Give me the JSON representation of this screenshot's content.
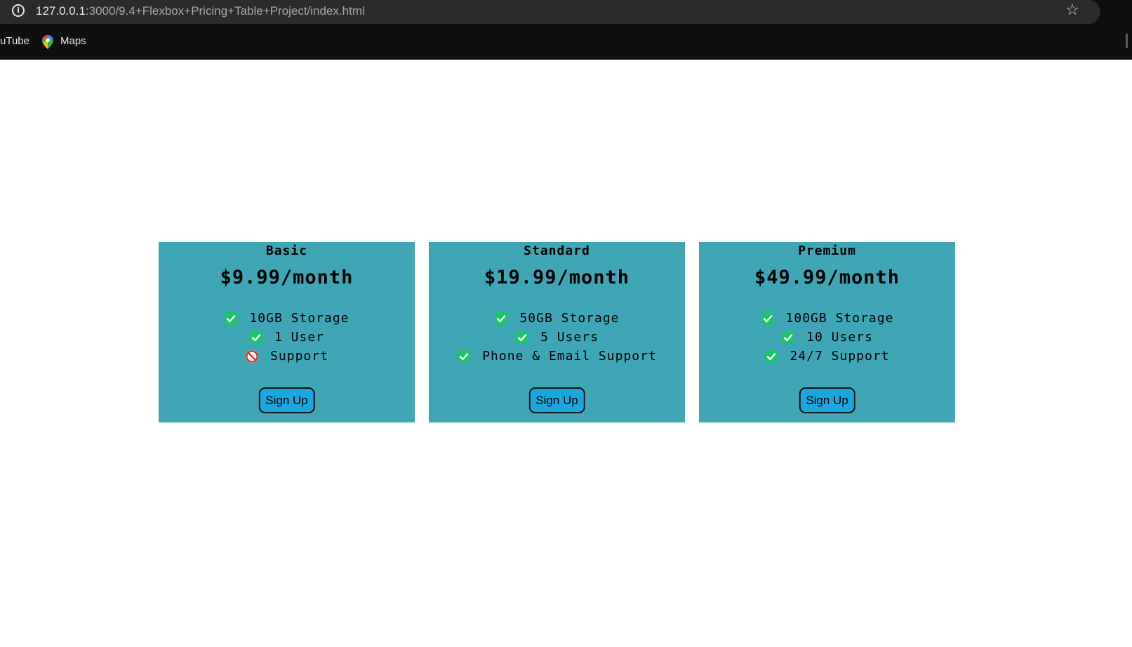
{
  "browser": {
    "url_host": "127.0.0.1",
    "url_rest": ":3000/9.4+Flexbox+Pricing+Table+Project/index.html",
    "info_icon": "info-icon",
    "star_icon": "star-icon",
    "bookmarks": [
      {
        "label": "uTube",
        "icon": "youtube-icon"
      },
      {
        "label": "Maps",
        "icon": "maps-pin-icon"
      }
    ]
  },
  "colors": {
    "card_background": "#3ea6b5",
    "button_background": "#1aa7e0",
    "check_green": "#1ec46a",
    "ban_red": "#d93025"
  },
  "plans": [
    {
      "name": "Basic",
      "price": "$9.99/month",
      "features": [
        {
          "text": "10GB Storage",
          "icon": "check-icon"
        },
        {
          "text": "1 User",
          "icon": "check-icon"
        },
        {
          "text": "Support",
          "icon": "ban-icon"
        }
      ],
      "button": "Sign Up"
    },
    {
      "name": "Standard",
      "price": "$19.99/month",
      "features": [
        {
          "text": "50GB Storage",
          "icon": "check-icon"
        },
        {
          "text": "5 Users",
          "icon": "check-icon"
        },
        {
          "text": "Phone & Email Support",
          "icon": "check-icon"
        }
      ],
      "button": "Sign Up"
    },
    {
      "name": "Premium",
      "price": "$49.99/month",
      "features": [
        {
          "text": "100GB Storage",
          "icon": "check-icon"
        },
        {
          "text": "10 Users",
          "icon": "check-icon"
        },
        {
          "text": "24/7 Support",
          "icon": "check-icon"
        }
      ],
      "button": "Sign Up"
    }
  ]
}
